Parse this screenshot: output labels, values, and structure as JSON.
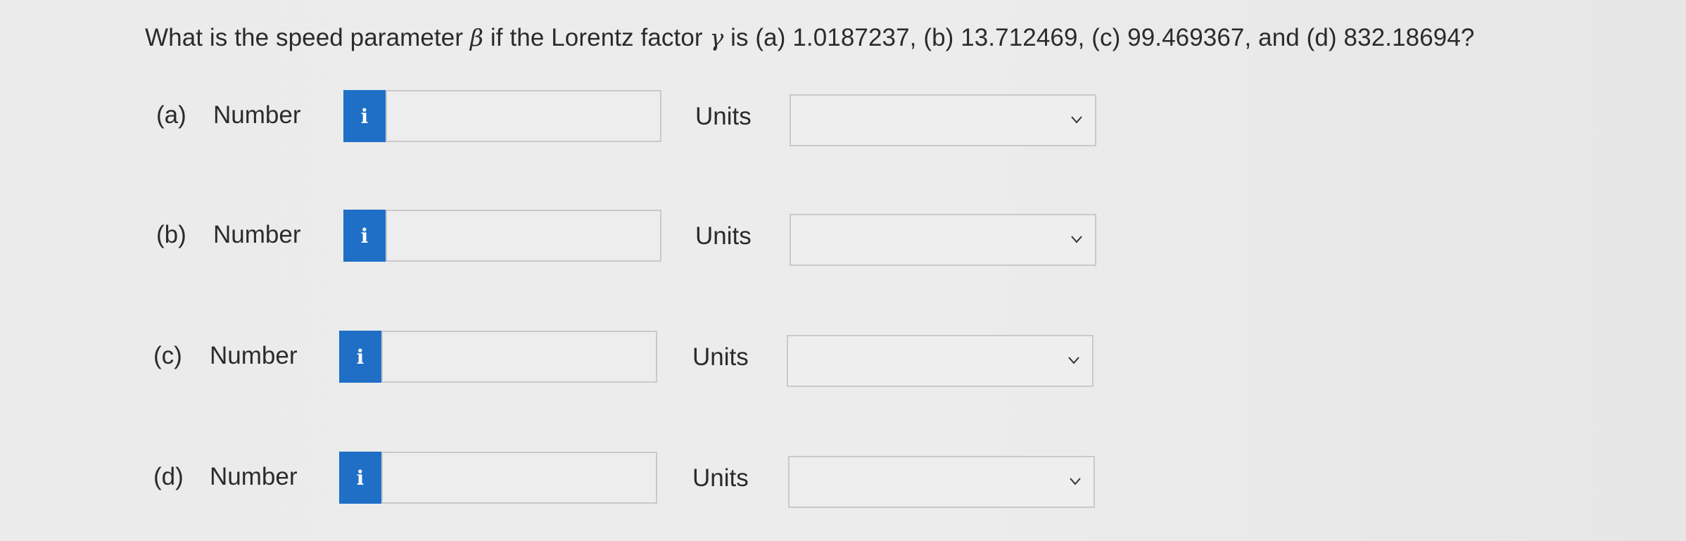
{
  "question": {
    "prefix": "What is the speed parameter ",
    "beta": "β",
    "middle": " if the Lorentz factor ",
    "gamma": "γ",
    "suffix": " is (a) 1.0187237, (b) 13.712469, (c) 99.469367, and (d) 832.18694?"
  },
  "parts": [
    {
      "label": "(a)",
      "number_label": "Number",
      "info_icon": "i",
      "number_value": "",
      "units_label": "Units",
      "units_value": ""
    },
    {
      "label": "(b)",
      "number_label": "Number",
      "info_icon": "i",
      "number_value": "",
      "units_label": "Units",
      "units_value": ""
    },
    {
      "label": "(c)",
      "number_label": "Number",
      "info_icon": "i",
      "number_value": "",
      "units_label": "Units",
      "units_value": ""
    },
    {
      "label": "(d)",
      "number_label": "Number",
      "info_icon": "i",
      "number_value": "",
      "units_label": "Units",
      "units_value": ""
    }
  ],
  "icons": {
    "info": "info-icon",
    "dropdown": "chevron-down-icon"
  },
  "colors": {
    "info_button": "#1f6fc7",
    "background": "#ebebeb",
    "field_border": "#c9c9c9"
  }
}
